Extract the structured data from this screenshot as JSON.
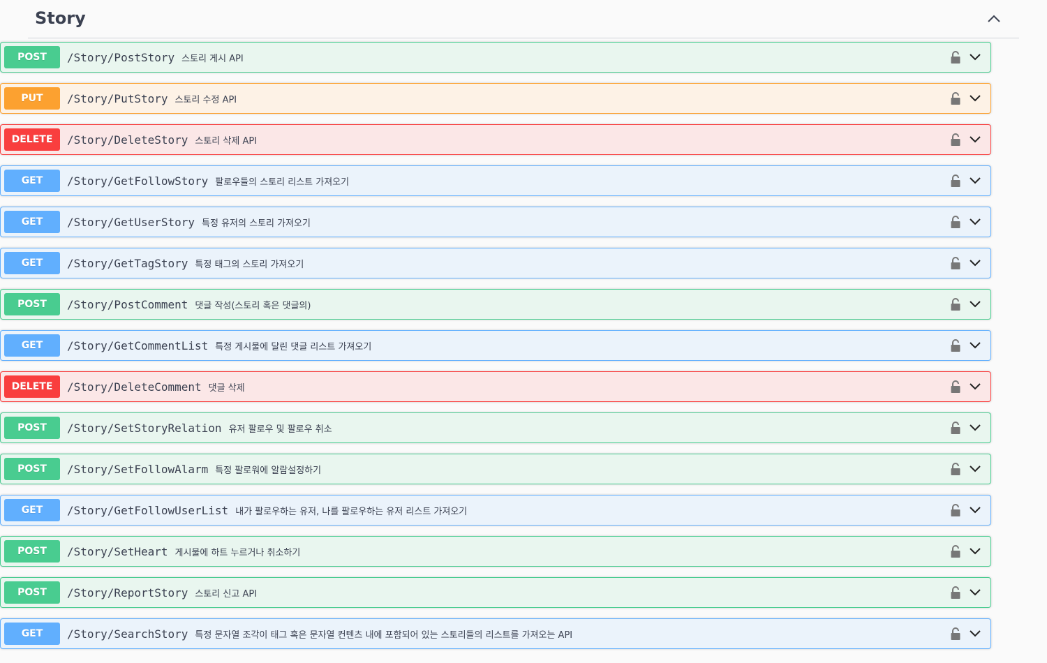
{
  "section": {
    "title": "Story",
    "collapse_icon": "chevron-up-icon"
  },
  "operations": [
    {
      "method": "POST",
      "path": "/Story/PostStory",
      "summary": "스토리 게시 API"
    },
    {
      "method": "PUT",
      "path": "/Story/PutStory",
      "summary": "스토리 수정 API"
    },
    {
      "method": "DELETE",
      "path": "/Story/DeleteStory",
      "summary": "스토리 삭제 API"
    },
    {
      "method": "GET",
      "path": "/Story/GetFollowStory",
      "summary": "팔로우들의 스토리 리스트 가져오기"
    },
    {
      "method": "GET",
      "path": "/Story/GetUserStory",
      "summary": "특정 유저의 스토리 가져오기"
    },
    {
      "method": "GET",
      "path": "/Story/GetTagStory",
      "summary": "특정 태그의 스토리 가져오기"
    },
    {
      "method": "POST",
      "path": "/Story/PostComment",
      "summary": "댓글 작성(스토리 혹은 댓글의)"
    },
    {
      "method": "GET",
      "path": "/Story/GetCommentList",
      "summary": "특정 게시물에 달린 댓글 리스트 가져오기"
    },
    {
      "method": "DELETE",
      "path": "/Story/DeleteComment",
      "summary": "댓글 삭제"
    },
    {
      "method": "POST",
      "path": "/Story/SetStoryRelation",
      "summary": "유저 팔로우 및 팔로우 취소"
    },
    {
      "method": "POST",
      "path": "/Story/SetFollowAlarm",
      "summary": "특정 팔로워에 알람설정하기"
    },
    {
      "method": "GET",
      "path": "/Story/GetFollowUserList",
      "summary": "내가 팔로우하는 유저, 나를 팔로우하는 유저 리스트 가져오기"
    },
    {
      "method": "POST",
      "path": "/Story/SetHeart",
      "summary": "게시물에 하트 누르거나 취소하기"
    },
    {
      "method": "POST",
      "path": "/Story/ReportStory",
      "summary": "스토리 신고 API"
    },
    {
      "method": "GET",
      "path": "/Story/SearchStory",
      "summary": "특정 문자열 조각이 태그 혹은 문자열 컨텐츠 내에 포함되어 있는 스토리들의 리스트를 가져오는 API"
    }
  ],
  "icons": {
    "lock": "unlocked-padlock-icon",
    "expand": "chevron-down-icon"
  },
  "colors": {
    "POST": "#49cc90",
    "PUT": "#fca130",
    "DELETE": "#f93e3e",
    "GET": "#61affe",
    "title_text": "#3b4151"
  }
}
